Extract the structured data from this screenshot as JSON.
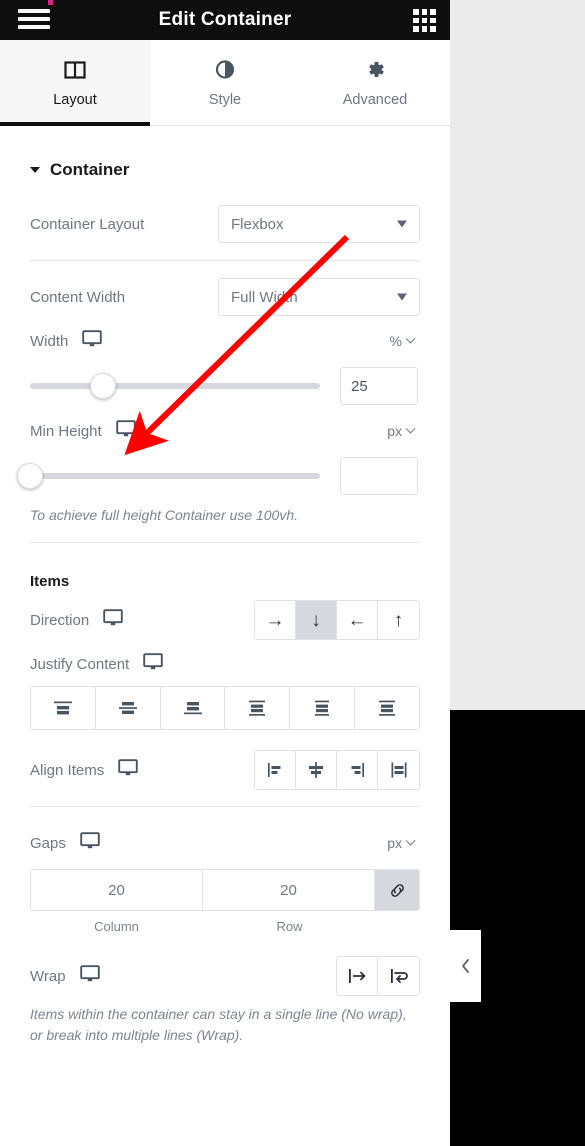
{
  "header": {
    "title": "Edit Container",
    "menu_icon": "hamburger-icon",
    "apps_icon": "grid-apps-icon"
  },
  "tabs": [
    {
      "label": "Layout",
      "icon": "layout-columns-icon",
      "active": true
    },
    {
      "label": "Style",
      "icon": "half-circle-contrast-icon",
      "active": false
    },
    {
      "label": "Advanced",
      "icon": "gear-icon",
      "active": false
    }
  ],
  "container_section": {
    "title": "Container",
    "collapsed": false,
    "container_layout": {
      "label": "Container Layout",
      "value": "Flexbox"
    },
    "content_width": {
      "label": "Content Width",
      "value": "Full Width"
    },
    "width": {
      "label": "Width",
      "unit": "%",
      "value": "25",
      "slider_percent": 25,
      "device_icon": "desktop-monitor-icon"
    },
    "min_height": {
      "label": "Min Height",
      "unit": "px",
      "value": "",
      "slider_percent": 0,
      "device_icon": "desktop-monitor-icon"
    },
    "min_height_hint": "To achieve full height Container use 100vh."
  },
  "items_section": {
    "title": "Items",
    "direction": {
      "label": "Direction",
      "device_icon": "desktop-monitor-icon",
      "options": [
        {
          "name": "row",
          "glyph": "→",
          "selected": false
        },
        {
          "name": "column",
          "glyph": "↓",
          "selected": true
        },
        {
          "name": "row-reverse",
          "glyph": "←",
          "selected": false
        },
        {
          "name": "column-reverse",
          "glyph": "↑",
          "selected": false
        }
      ]
    },
    "justify_content": {
      "label": "Justify Content",
      "device_icon": "desktop-monitor-icon",
      "options": [
        {
          "name": "flex-start",
          "selected": false
        },
        {
          "name": "center",
          "selected": false
        },
        {
          "name": "flex-end",
          "selected": false
        },
        {
          "name": "space-between",
          "selected": false
        },
        {
          "name": "space-around",
          "selected": false
        },
        {
          "name": "space-evenly",
          "selected": false
        }
      ]
    },
    "align_items": {
      "label": "Align Items",
      "device_icon": "desktop-monitor-icon",
      "options": [
        {
          "name": "flex-start",
          "selected": false
        },
        {
          "name": "center",
          "selected": false
        },
        {
          "name": "flex-end",
          "selected": false
        },
        {
          "name": "stretch",
          "selected": false
        }
      ]
    },
    "gaps": {
      "label": "Gaps",
      "device_icon": "desktop-monitor-icon",
      "unit": "px",
      "column_value": "20",
      "column_label": "Column",
      "row_value": "20",
      "row_label": "Row",
      "link_active": true,
      "link_icon": "link-chain-icon"
    },
    "wrap": {
      "label": "Wrap",
      "device_icon": "desktop-monitor-icon",
      "options": [
        {
          "name": "nowrap",
          "selected": false
        },
        {
          "name": "wrap",
          "selected": false
        }
      ],
      "hint": "Items within the container can stay in a single line (No wrap), or break into multiple lines (Wrap)."
    }
  },
  "canvas": {
    "collapse_icon": "chevron-left-icon"
  },
  "annotation": {
    "arrow_color": "#FF0000",
    "points_to": "width-slider-handle"
  },
  "colors": {
    "header_bg": "#0e0e0e",
    "panel_bg": "#ffffff",
    "canvas_bg": "#ebebeb",
    "muted_text": "#6d7882",
    "border": "#e0e2e5",
    "selected_bg": "#d5d8dc"
  }
}
